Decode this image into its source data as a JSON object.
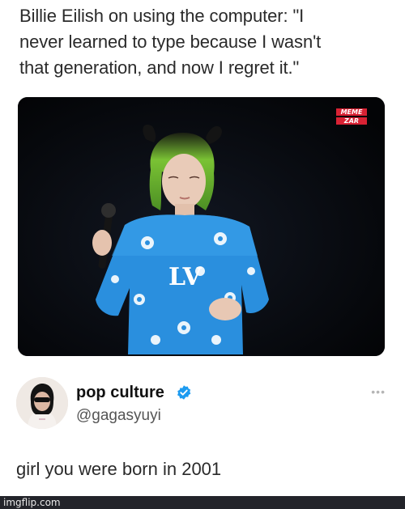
{
  "headline": "Billie Eilish on using the computer: \"I\nnever learned to type because I wasn't\nthat generation, and now I regret it.\"",
  "photo": {
    "watermark_line1": "MEME",
    "watermark_line2": "ZAR",
    "shirt_logo": "LV"
  },
  "tweet": {
    "display_name": "pop culture",
    "handle": "@gagasyuyi",
    "more_label": "•••",
    "reply_text": "girl you were born in 2001"
  },
  "footer": {
    "site": "imgflip.com"
  }
}
